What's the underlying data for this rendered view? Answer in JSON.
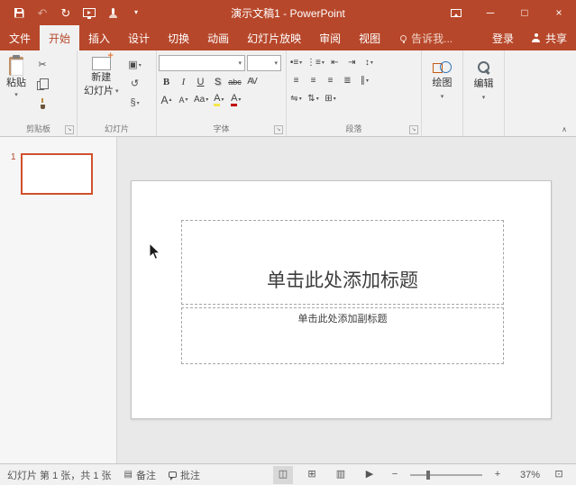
{
  "title_bar": {
    "title": "演示文稿1 - PowerPoint"
  },
  "tabs": {
    "file": "文件",
    "items": [
      {
        "label": "开始"
      },
      {
        "label": "插入"
      },
      {
        "label": "设计"
      },
      {
        "label": "切换"
      },
      {
        "label": "动画"
      },
      {
        "label": "幻灯片放映"
      },
      {
        "label": "审阅"
      },
      {
        "label": "视图"
      }
    ],
    "tell_me": "告诉我...",
    "sign_in": "登录",
    "share": "共享"
  },
  "ribbon": {
    "paste_label": "粘贴",
    "clipboard_group": "剪贴板",
    "new_slide_line1": "新建",
    "new_slide_line2": "幻灯片",
    "slides_group": "幻灯片",
    "font_group": "字体",
    "paragraph_group": "段落",
    "drawing_label": "绘图",
    "editing_label": "编辑",
    "font_name_value": "",
    "font_size_value": ""
  },
  "font_buttons": {
    "bold": "B",
    "italic": "I",
    "underline": "U",
    "shadow": "S",
    "strike": "abc",
    "spacing": "AV",
    "grow": "A",
    "shrink": "A",
    "case": "Aa",
    "highlight": "A",
    "color": "A"
  },
  "icons": {
    "undo": "↶",
    "redo": "↻",
    "dropdown": "▾",
    "dropup": "▴",
    "minimize": "─",
    "maximize": "□",
    "close": "×",
    "cut": "✂",
    "layout": "▣",
    "reset": "↺",
    "section": "§",
    "bullets": "•≡",
    "numbering": "⋮≡",
    "indent_decrease": "⇤",
    "indent_increase": "⇥",
    "line_spacing": "↕",
    "text_direction": "⇋",
    "align_text": "⇅",
    "smartart": "⊞",
    "align_left": "≡",
    "align_center": "≡",
    "align_right": "≡",
    "justify": "≣",
    "columns": "∥",
    "launcher": "↘",
    "collapse_ribbon": "∧",
    "notes": "▤",
    "normal_view": "◫",
    "slide_sorter": "⊞",
    "reading_view": "▥",
    "slideshow_view": "▶",
    "zoom_out": "−",
    "zoom_in": "+",
    "fit_window": "⊡"
  },
  "slide_panel": {
    "slide_number": "1"
  },
  "slide": {
    "title_placeholder": "单击此处添加标题",
    "subtitle_placeholder": "单击此处添加副标题"
  },
  "status_bar": {
    "slide_indicator": "幻灯片 第 1 张，共 1 张",
    "notes_label": "备注",
    "comments_label": "批注",
    "zoom_level": "37%"
  }
}
